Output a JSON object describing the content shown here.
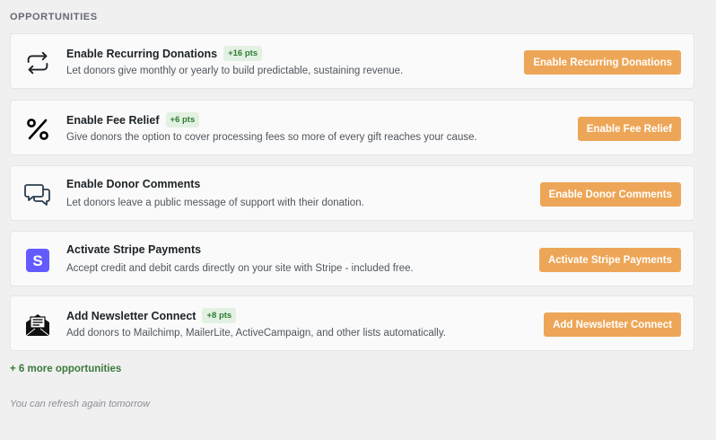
{
  "section": {
    "title": "OPPORTUNITIES"
  },
  "opportunities": [
    {
      "icon": "recurring-arrows-icon",
      "title": "Enable Recurring Donations",
      "badge": "+16 pts",
      "description": "Let donors give monthly or yearly to build predictable, sustaining revenue.",
      "action": "Enable Recurring Donations"
    },
    {
      "icon": "percent-icon",
      "title": "Enable Fee Relief",
      "badge": "+6 pts",
      "description": "Give donors the option to cover processing fees so more of every gift reaches your cause.",
      "action": "Enable Fee Relief"
    },
    {
      "icon": "comments-icon",
      "title": "Enable Donor Comments",
      "badge": "",
      "description": "Let donors leave a public message of support with their donation.",
      "action": "Enable Donor Comments"
    },
    {
      "icon": "stripe-icon",
      "title": "Activate Stripe Payments",
      "badge": "",
      "description": "Accept credit and debit cards directly on your site with Stripe - included free.",
      "action": "Activate Stripe Payments"
    },
    {
      "icon": "newsletter-icon",
      "title": "Add Newsletter Connect",
      "badge": "+8 pts",
      "description": "Add donors to Mailchimp, MailerLite, ActiveCampaign, and other lists automatically.",
      "action": "Add Newsletter Connect"
    }
  ],
  "more_link": "+ 6 more opportunities",
  "refresh_note": "You can refresh again tomorrow",
  "colors": {
    "accent": "#eda657",
    "badge_text": "#2e7d32",
    "badge_bg": "#e3f1e3",
    "stripe": "#635bff",
    "link": "#3c7a3a"
  }
}
